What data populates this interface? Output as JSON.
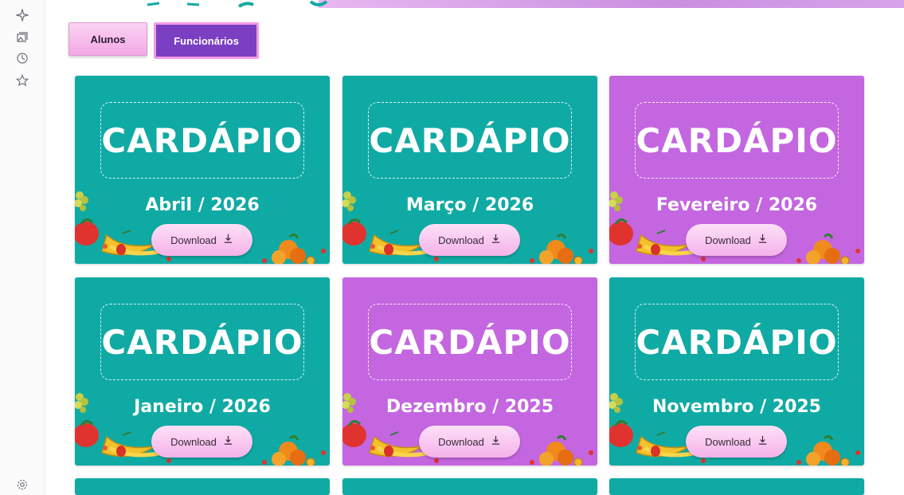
{
  "colors": {
    "teal": "#10aaa4",
    "purple": "#c466e0",
    "tab_active": "#7b3fc1",
    "tab_inactive": "#f7bdec",
    "button_pink": "#f5b2ea"
  },
  "sidebar": {
    "icons": [
      "sparkle-icon",
      "gallery-icon",
      "history-icon",
      "star-icon",
      "settings-icon"
    ]
  },
  "tabs": {
    "alunos": "Alunos",
    "funcionarios": "Funcionários",
    "active": "funcionarios"
  },
  "cards": [
    {
      "title": "CARDÁPIO",
      "month": "Abril / 2026",
      "download": "Download",
      "color": "teal"
    },
    {
      "title": "CARDÁPIO",
      "month": "Março / 2026",
      "download": "Download",
      "color": "teal"
    },
    {
      "title": "CARDÁPIO",
      "month": "Fevereiro / 2026",
      "download": "Download",
      "color": "purple"
    },
    {
      "title": "CARDÁPIO",
      "month": "Janeiro / 2026",
      "download": "Download",
      "color": "teal"
    },
    {
      "title": "CARDÁPIO",
      "month": "Dezembro / 2025",
      "download": "Download",
      "color": "purple"
    },
    {
      "title": "CARDÁPIO",
      "month": "Novembro / 2025",
      "download": "Download",
      "color": "teal"
    }
  ],
  "partial_cards": [
    "teal",
    "teal",
    "teal"
  ]
}
